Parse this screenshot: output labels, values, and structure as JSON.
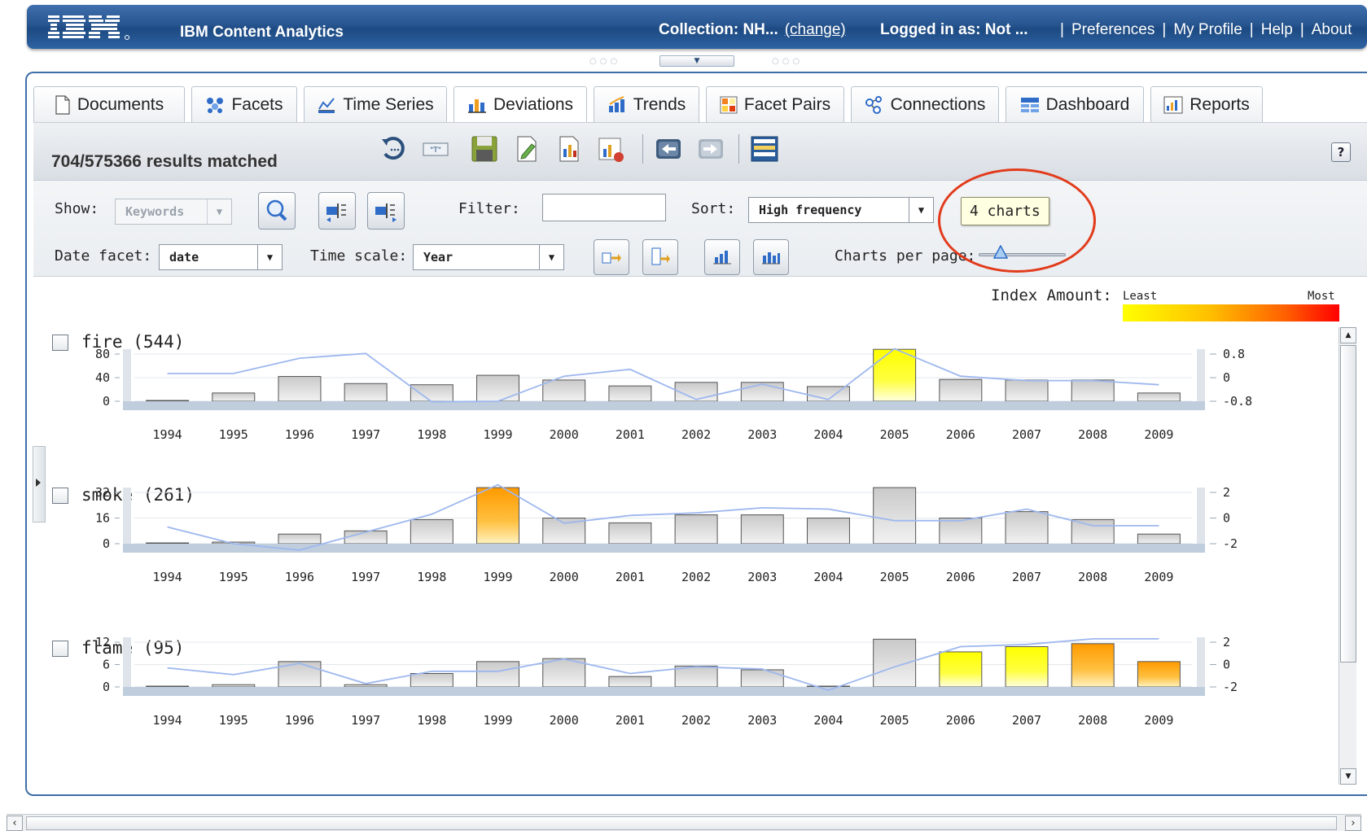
{
  "header": {
    "brand": "IBM",
    "app_title": "IBM Content Analytics",
    "collection_label": "Collection: NH...",
    "change_link": "(change)",
    "logged_in": "Logged in as: Not ...",
    "links": [
      "Preferences",
      "My Profile",
      "Help",
      "About"
    ]
  },
  "tabs": [
    {
      "label": "Documents",
      "icon": "document-icon"
    },
    {
      "label": "Facets",
      "icon": "facets-icon"
    },
    {
      "label": "Time Series",
      "icon": "time-series-icon"
    },
    {
      "label": "Deviations",
      "icon": "deviations-icon",
      "active": true
    },
    {
      "label": "Trends",
      "icon": "trends-icon"
    },
    {
      "label": "Facet Pairs",
      "icon": "facet-pairs-icon"
    },
    {
      "label": "Connections",
      "icon": "connections-icon"
    },
    {
      "label": "Dashboard",
      "icon": "dashboard-icon"
    },
    {
      "label": "Reports",
      "icon": "reports-icon"
    }
  ],
  "toolbar": {
    "results_matched": "704/575366 results matched",
    "help_label": "?"
  },
  "options": {
    "show_label": "Show:",
    "show_value": "Keywords",
    "filter_label": "Filter:",
    "filter_value": "",
    "sort_label": "Sort:",
    "sort_value": "High frequency",
    "date_facet_label": "Date facet:",
    "date_facet_value": "date",
    "time_scale_label": "Time scale:",
    "time_scale_value": "Year",
    "charts_per_page_label": "Charts per page:",
    "tooltip": "4 charts",
    "charts_per_page_level": 0.25
  },
  "legend": {
    "label": "Index Amount:",
    "least": "Least",
    "most": "Most"
  },
  "colors": {
    "header_blue": "#27558f",
    "bar_gray": "#d4d4d4",
    "bar_yellow": "#ffff00",
    "bar_orange": "#ffa500",
    "line_blue": "#9db7ee",
    "highlight_red": "#e23b1c"
  },
  "chart_data": [
    {
      "type": "bar",
      "title": "fire (544)",
      "categories": [
        "1994",
        "1995",
        "1996",
        "1997",
        "1998",
        "1999",
        "2000",
        "2001",
        "2002",
        "2003",
        "2004",
        "2005",
        "2006",
        "2007",
        "2008",
        "2009"
      ],
      "values": [
        0,
        14,
        42,
        30,
        28,
        44,
        36,
        26,
        32,
        32,
        25,
        88,
        37,
        36,
        36,
        14
      ],
      "highlight": [
        "",
        "",
        "",
        "",
        "",
        "",
        "",
        "",
        "",
        "",
        "",
        "yellow",
        "",
        "",
        "",
        ""
      ],
      "ylim": [
        0,
        80
      ],
      "yticks": [
        "0",
        "40",
        "80"
      ],
      "line_series": [
        0.14,
        0.14,
        0.66,
        0.82,
        -0.82,
        -0.8,
        0.05,
        0.28,
        -0.74,
        -0.22,
        -0.74,
        0.98,
        0.05,
        -0.1,
        -0.1,
        -0.24
      ],
      "y2ticks": [
        "-0.8",
        "0",
        "0.8"
      ],
      "y2lim": [
        -0.8,
        0.8
      ]
    },
    {
      "type": "bar",
      "title": "smoke (261)",
      "categories": [
        "1994",
        "1995",
        "1996",
        "1997",
        "1998",
        "1999",
        "2000",
        "2001",
        "2002",
        "2003",
        "2004",
        "2005",
        "2006",
        "2007",
        "2008",
        "2009"
      ],
      "values": [
        0,
        1,
        6,
        8,
        15,
        35,
        16,
        13,
        18,
        18,
        16,
        35,
        16,
        20,
        15,
        6
      ],
      "highlight": [
        "",
        "",
        "",
        "",
        "",
        "orange",
        "",
        "",
        "",
        "",
        "",
        "",
        "",
        "",
        "",
        ""
      ],
      "ylim": [
        0,
        32
      ],
      "yticks": [
        "0",
        "16",
        "32"
      ],
      "line_series": [
        -0.7,
        -2.0,
        -2.5,
        -1.1,
        0.3,
        2.6,
        -0.4,
        0.2,
        0.4,
        0.8,
        0.7,
        -0.2,
        -0.2,
        0.7,
        -0.6,
        -0.6
      ],
      "y2ticks": [
        "-2",
        "0",
        "2"
      ],
      "y2lim": [
        -2,
        2
      ]
    },
    {
      "type": "bar",
      "title": "flame (95)",
      "categories": [
        "1994",
        "1995",
        "1996",
        "1997",
        "1998",
        "1999",
        "2000",
        "2001",
        "2002",
        "2003",
        "2004",
        "2005",
        "2006",
        "2007",
        "2008",
        "2009"
      ],
      "values": [
        0,
        0.6,
        6.8,
        0.6,
        3.6,
        6.8,
        7.6,
        2.8,
        5.6,
        4.6,
        0.2,
        12.8,
        9.4,
        10.8,
        11.6,
        6.8
      ],
      "highlight": [
        "",
        "",
        "",
        "",
        "",
        "",
        "",
        "",
        "",
        "",
        "",
        "",
        "yellow",
        "yellow",
        "orange",
        "orange"
      ],
      "ylim": [
        0,
        12
      ],
      "yticks": [
        "0",
        "6",
        "12"
      ],
      "line_series": [
        -0.3,
        -0.9,
        0.1,
        -1.7,
        -0.6,
        -0.6,
        0.5,
        -0.8,
        -0.2,
        -0.4,
        -2.3,
        -0.2,
        1.6,
        1.8,
        2.3,
        2.3
      ],
      "y2ticks": [
        "-2",
        "0",
        "2"
      ],
      "y2lim": [
        -2,
        2
      ]
    }
  ]
}
